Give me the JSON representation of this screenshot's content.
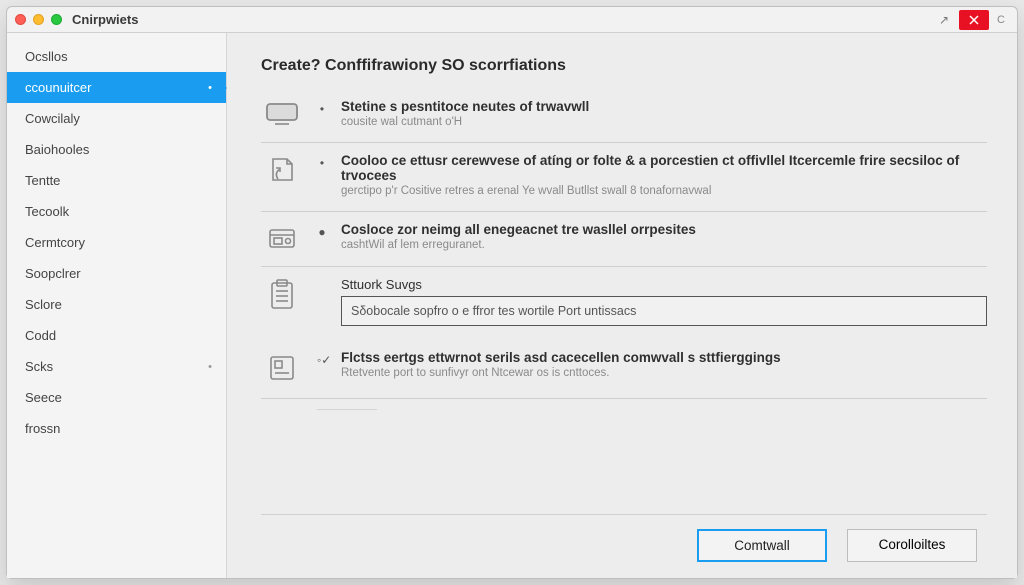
{
  "titlebar": {
    "title": "Cnirpwiets",
    "corner_tag": "C"
  },
  "sidebar": {
    "items": [
      {
        "label": "Ocsllos",
        "selected": false,
        "dot": ""
      },
      {
        "label": "ccounuitcer",
        "selected": true,
        "dot": "•"
      },
      {
        "label": "Cowcilaly",
        "selected": false,
        "dot": ""
      },
      {
        "label": "Baiohooles",
        "selected": false,
        "dot": ""
      },
      {
        "label": "Tentte",
        "selected": false,
        "dot": ""
      },
      {
        "label": "Tecoolk",
        "selected": false,
        "dot": ""
      },
      {
        "label": "Cermtcory",
        "selected": false,
        "dot": ""
      },
      {
        "label": "Soopclrer",
        "selected": false,
        "dot": ""
      },
      {
        "label": "Sclore",
        "selected": false,
        "dot": ""
      },
      {
        "label": "Codd",
        "selected": false,
        "dot": ""
      },
      {
        "label": "Scks",
        "selected": false,
        "dot": "•"
      },
      {
        "label": "Seece",
        "selected": false,
        "dot": ""
      },
      {
        "label": "frossn",
        "selected": false,
        "dot": ""
      }
    ]
  },
  "content": {
    "title": "Create? Conffifrawiony SO scorrfiations",
    "rows": [
      {
        "icon": "screen-icon",
        "bullet": "•",
        "heading": "Stetine s pesntitoce neutes of trwavwll",
        "sub": "cousite wal cutmant o'H"
      },
      {
        "icon": "doc-arrow-icon",
        "bullet": "•",
        "heading": "Cooloo ce ettusr cerewvese of atíng or folte & a porcestien ct offivllel Itcercemle frire secsiloc of trvocees",
        "sub": "gerctipo p'r Cositive retres a erenal Ye wvall Butllst swall 8 tonafornavwal"
      },
      {
        "icon": "box-icon",
        "bullet": "●",
        "heading": "Cosloce zor neimg all enegeacnet tre wasllel orrpesites",
        "sub": "cashtWil af lem erreguranet."
      }
    ],
    "input_row": {
      "icon": "clipboard-icon",
      "label": "Sttuork Suvgs",
      "value": "Sδobocale sopfro o e ffror tes wortile Port untissacs"
    },
    "last_row": {
      "icon": "card-icon",
      "bullet": "◦✓",
      "heading": "Flctss eertgs ettwrnot serils asd cacecellen comwvall s sttfierggings",
      "sub": "Rtetvente port to sunfivyr ont Ntcewar os is cnttoces."
    }
  },
  "footer": {
    "primary": "Comtwall",
    "secondary": "Corolloiltes"
  }
}
